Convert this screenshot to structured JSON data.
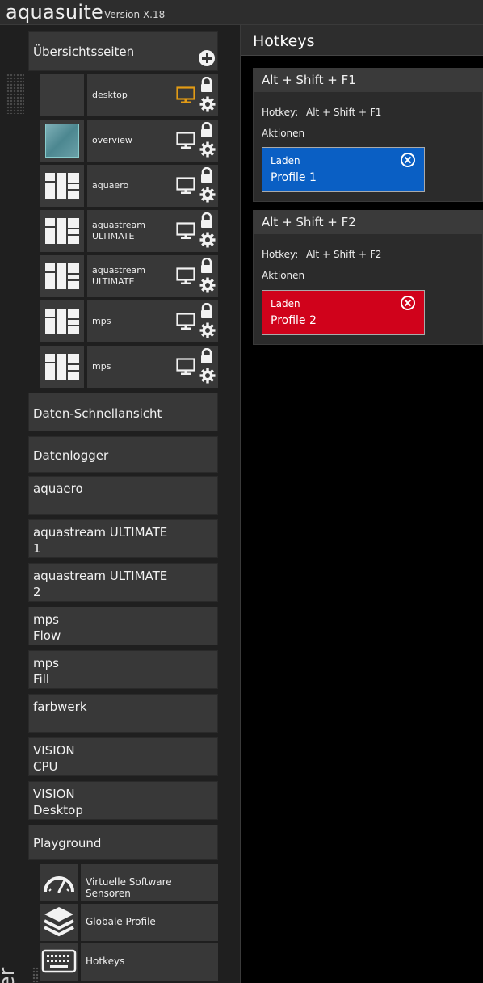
{
  "titlebar": {
    "app_name": "aquasuite",
    "version": "Version X.18"
  },
  "sidebar": {
    "vertical_label": "uter",
    "overview_group": {
      "label": "Übersichtsseiten",
      "pages": [
        {
          "label": "desktop",
          "thumb": "blank",
          "monitor_color": "#e39b15"
        },
        {
          "label": "overview",
          "thumb": "image",
          "monitor_color": "#f2f2f2"
        },
        {
          "label": "aquaero",
          "thumb": "grid",
          "monitor_color": "#f2f2f2"
        },
        {
          "label": "aquastream ULTIMATE",
          "thumb": "grid",
          "monitor_color": "#f2f2f2"
        },
        {
          "label": "aquastream ULTIMATE",
          "thumb": "grid",
          "monitor_color": "#f2f2f2"
        },
        {
          "label": "mps",
          "thumb": "grid",
          "monitor_color": "#f2f2f2"
        },
        {
          "label": "mps",
          "thumb": "grid",
          "monitor_color": "#f2f2f2"
        }
      ]
    },
    "items": [
      {
        "line1": "Daten-Schnellansicht",
        "line2": ""
      },
      {
        "line1": "Datenlogger",
        "line2": ""
      },
      {
        "line1": "aquaero",
        "line2": ""
      },
      {
        "line1": "aquastream ULTIMATE",
        "line2": "1"
      },
      {
        "line1": "aquastream ULTIMATE",
        "line2": "2"
      },
      {
        "line1": "mps",
        "line2": "Flow"
      },
      {
        "line1": "mps",
        "line2": "Fill"
      },
      {
        "line1": "farbwerk",
        "line2": ""
      },
      {
        "line1": "VISION",
        "line2": "CPU"
      },
      {
        "line1": "VISION",
        "line2": "Desktop"
      },
      {
        "line1": "Playground",
        "line2": ""
      }
    ],
    "tools": [
      {
        "label": "Virtuelle Software Sensoren",
        "icon": "gauge-icon"
      },
      {
        "label": "Globale Profile",
        "icon": "layers-icon"
      },
      {
        "label": "Hotkeys",
        "icon": "keyboard-icon"
      }
    ]
  },
  "main": {
    "title": "Hotkeys",
    "hotkeys": [
      {
        "header": "Alt + Shift + F1",
        "hotkey_label": "Hotkey:",
        "hotkey_value": "Alt + Shift + F1",
        "actions_label": "Aktionen",
        "action": {
          "type": "Laden",
          "target": "Profile 1",
          "color": "#0a5fc4"
        }
      },
      {
        "header": "Alt + Shift + F2",
        "hotkey_label": "Hotkey:",
        "hotkey_value": "Alt + Shift + F2",
        "actions_label": "Aktionen",
        "action": {
          "type": "Laden",
          "target": "Profile 2",
          "color": "#d0021b"
        }
      }
    ]
  }
}
